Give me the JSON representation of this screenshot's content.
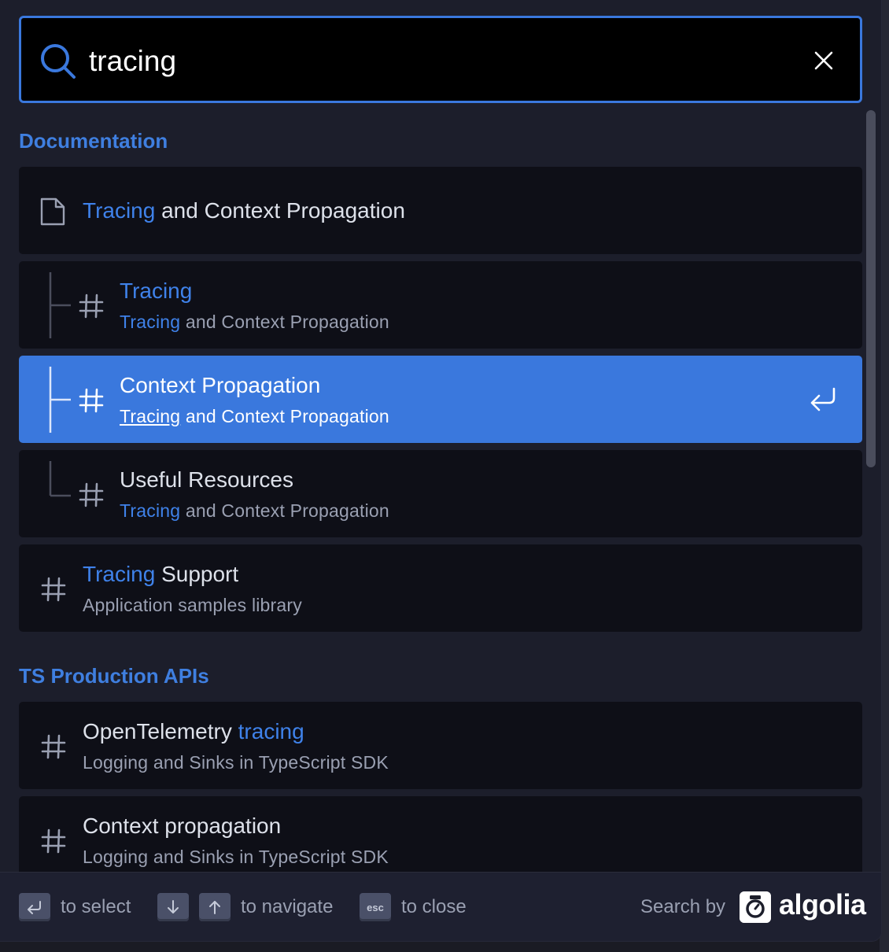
{
  "search": {
    "value": "tracing"
  },
  "sections": [
    {
      "title": "Documentation",
      "hits": [
        {
          "title_hl": "Tracing",
          "title_rest": " and Context Propagation"
        },
        {
          "title_hl": "Tracing",
          "path_hl": "Tracing",
          "path_rest": " and Context Propagation"
        },
        {
          "title": "Context Propagation",
          "path_hl": "Tracing",
          "path_rest": " and Context Propagation"
        },
        {
          "title": "Useful Resources",
          "path_hl": "Tracing",
          "path_rest": " and Context Propagation"
        },
        {
          "title_hl": "Tracing",
          "title_rest": " Support",
          "path": "Application samples library"
        }
      ]
    },
    {
      "title": "TS Production APIs",
      "hits": [
        {
          "title_pre": "OpenTelemetry ",
          "title_hl": "tracing",
          "path": "Logging and Sinks in TypeScript SDK"
        },
        {
          "title": "Context propagation",
          "path": "Logging and Sinks in TypeScript SDK"
        }
      ]
    }
  ],
  "footer": {
    "select_label": "to select",
    "navigate_label": "to navigate",
    "esc_key": "esc",
    "close_label": "to close",
    "search_by": "Search by",
    "brand": "algolia"
  },
  "colors": {
    "accent": "#3a78dd",
    "highlight": "#3f82ea",
    "hit_bg": "#0e0f17",
    "modal_bg": "#1c1e2b"
  },
  "icons": [
    "search-icon",
    "close-icon",
    "document-icon",
    "hash-icon",
    "enter-icon",
    "arrow-down-icon",
    "arrow-up-icon",
    "algolia-logo"
  ]
}
